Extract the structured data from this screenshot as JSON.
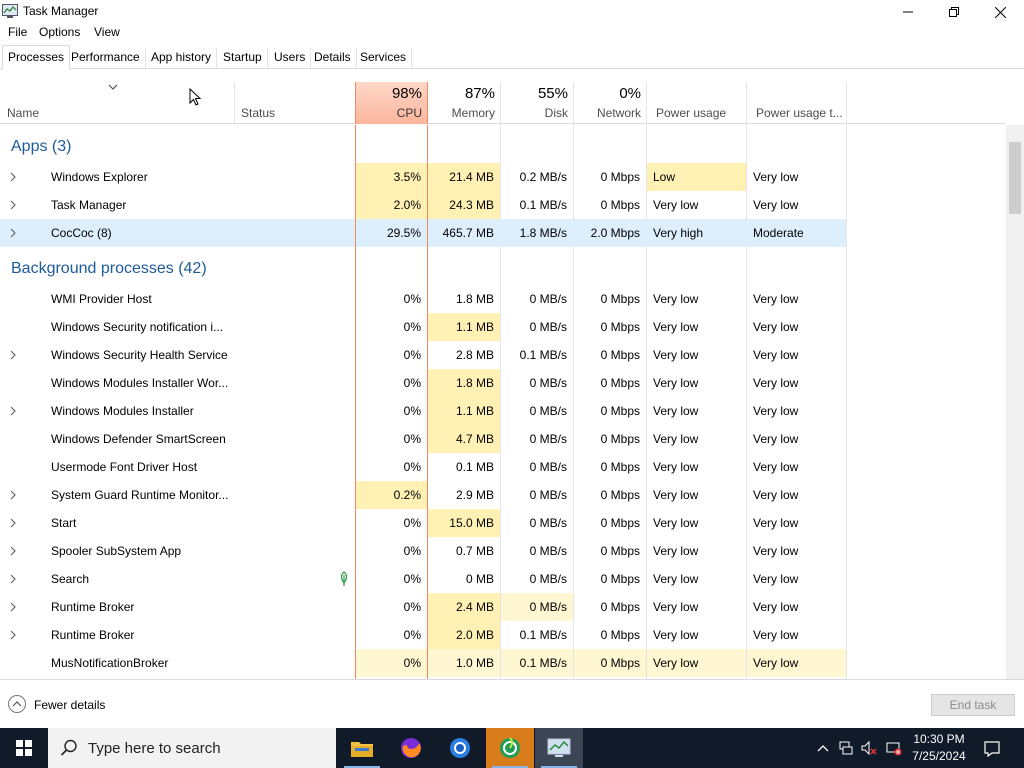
{
  "window": {
    "title": "Task Manager"
  },
  "menu": [
    "File",
    "Options",
    "View"
  ],
  "tabs": [
    "Processes",
    "Performance",
    "App history",
    "Startup",
    "Users",
    "Details",
    "Services"
  ],
  "header": {
    "name": "Name",
    "status": "Status",
    "cpu_pct": "98%",
    "cpu": "CPU",
    "mem_pct": "87%",
    "mem": "Memory",
    "disk_pct": "55%",
    "disk": "Disk",
    "net_pct": "0%",
    "net": "Network",
    "power": "Power usage",
    "power_trend": "Power usage t..."
  },
  "groups": {
    "apps": "Apps (3)",
    "background": "Background processes (42)"
  },
  "apps": [
    {
      "name": "Windows Explorer",
      "cpu": "3.5%",
      "mem": "21.4 MB",
      "disk": "0.2 MB/s",
      "net": "0 Mbps",
      "power": "Low",
      "trend": "Very low"
    },
    {
      "name": "Task Manager",
      "cpu": "2.0%",
      "mem": "24.3 MB",
      "disk": "0.1 MB/s",
      "net": "0 Mbps",
      "power": "Very low",
      "trend": "Very low"
    },
    {
      "name": "CocCoc (8)",
      "cpu": "29.5%",
      "mem": "465.7 MB",
      "disk": "1.8 MB/s",
      "net": "2.0 Mbps",
      "power": "Very high",
      "trend": "Moderate"
    }
  ],
  "background": [
    {
      "name": "WMI Provider Host",
      "cpu": "0%",
      "mem": "1.8 MB",
      "disk": "0 MB/s",
      "net": "0 Mbps",
      "power": "Very low",
      "trend": "Very low"
    },
    {
      "name": "Windows Security notification i...",
      "cpu": "0%",
      "mem": "1.1 MB",
      "disk": "0 MB/s",
      "net": "0 Mbps",
      "power": "Very low",
      "trend": "Very low"
    },
    {
      "name": "Windows Security Health Service",
      "cpu": "0%",
      "mem": "2.8 MB",
      "disk": "0.1 MB/s",
      "net": "0 Mbps",
      "power": "Very low",
      "trend": "Very low"
    },
    {
      "name": "Windows Modules Installer Wor...",
      "cpu": "0%",
      "mem": "1.8 MB",
      "disk": "0 MB/s",
      "net": "0 Mbps",
      "power": "Very low",
      "trend": "Very low"
    },
    {
      "name": "Windows Modules Installer",
      "cpu": "0%",
      "mem": "1.1 MB",
      "disk": "0 MB/s",
      "net": "0 Mbps",
      "power": "Very low",
      "trend": "Very low"
    },
    {
      "name": "Windows Defender SmartScreen",
      "cpu": "0%",
      "mem": "4.7 MB",
      "disk": "0 MB/s",
      "net": "0 Mbps",
      "power": "Very low",
      "trend": "Very low"
    },
    {
      "name": "Usermode Font Driver Host",
      "cpu": "0%",
      "mem": "0.1 MB",
      "disk": "0 MB/s",
      "net": "0 Mbps",
      "power": "Very low",
      "trend": "Very low"
    },
    {
      "name": "System Guard Runtime Monitor...",
      "cpu": "0.2%",
      "mem": "2.9 MB",
      "disk": "0 MB/s",
      "net": "0 Mbps",
      "power": "Very low",
      "trend": "Very low"
    },
    {
      "name": "Start",
      "cpu": "0%",
      "mem": "15.0 MB",
      "disk": "0 MB/s",
      "net": "0 Mbps",
      "power": "Very low",
      "trend": "Very low"
    },
    {
      "name": "Spooler SubSystem App",
      "cpu": "0%",
      "mem": "0.7 MB",
      "disk": "0 MB/s",
      "net": "0 Mbps",
      "power": "Very low",
      "trend": "Very low"
    },
    {
      "name": "Search",
      "cpu": "0%",
      "mem": "0 MB",
      "disk": "0 MB/s",
      "net": "0 Mbps",
      "power": "Very low",
      "trend": "Very low"
    },
    {
      "name": "Runtime Broker",
      "cpu": "0%",
      "mem": "2.4 MB",
      "disk": "0 MB/s",
      "net": "0 Mbps",
      "power": "Very low",
      "trend": "Very low"
    },
    {
      "name": "Runtime Broker",
      "cpu": "0%",
      "mem": "2.0 MB",
      "disk": "0.1 MB/s",
      "net": "0 Mbps",
      "power": "Very low",
      "trend": "Very low"
    },
    {
      "name": "MusNotificationBroker",
      "cpu": "0%",
      "mem": "1.0 MB",
      "disk": "0.1 MB/s",
      "net": "0 Mbps",
      "power": "Very low",
      "trend": "Very low"
    }
  ],
  "footer": {
    "fewer_details": "Fewer details",
    "end_task": "End task"
  },
  "taskbar": {
    "search_placeholder": "Type here to search",
    "time": "10:30 PM",
    "date": "7/25/2024"
  }
}
